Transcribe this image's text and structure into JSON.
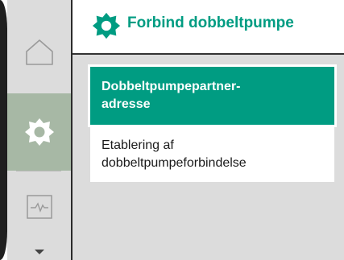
{
  "header": {
    "title": "Forbind dobbeltpumpe",
    "icon": "gear-icon",
    "accent_color": "#009c82"
  },
  "sidebar": {
    "items": [
      {
        "name": "home",
        "icon": "home-icon",
        "selected": false
      },
      {
        "name": "settings",
        "icon": "gear-icon",
        "selected": true
      },
      {
        "name": "diagnostics",
        "icon": "monitor-icon",
        "selected": false
      }
    ],
    "more_icon": "chevron-down-icon"
  },
  "menu": {
    "items": [
      {
        "label": "Dobbeltpumpepartner-\nadresse",
        "selected": true
      },
      {
        "label": "Etablering af\ndobbeltpumpeforbindelse",
        "selected": false
      }
    ]
  }
}
